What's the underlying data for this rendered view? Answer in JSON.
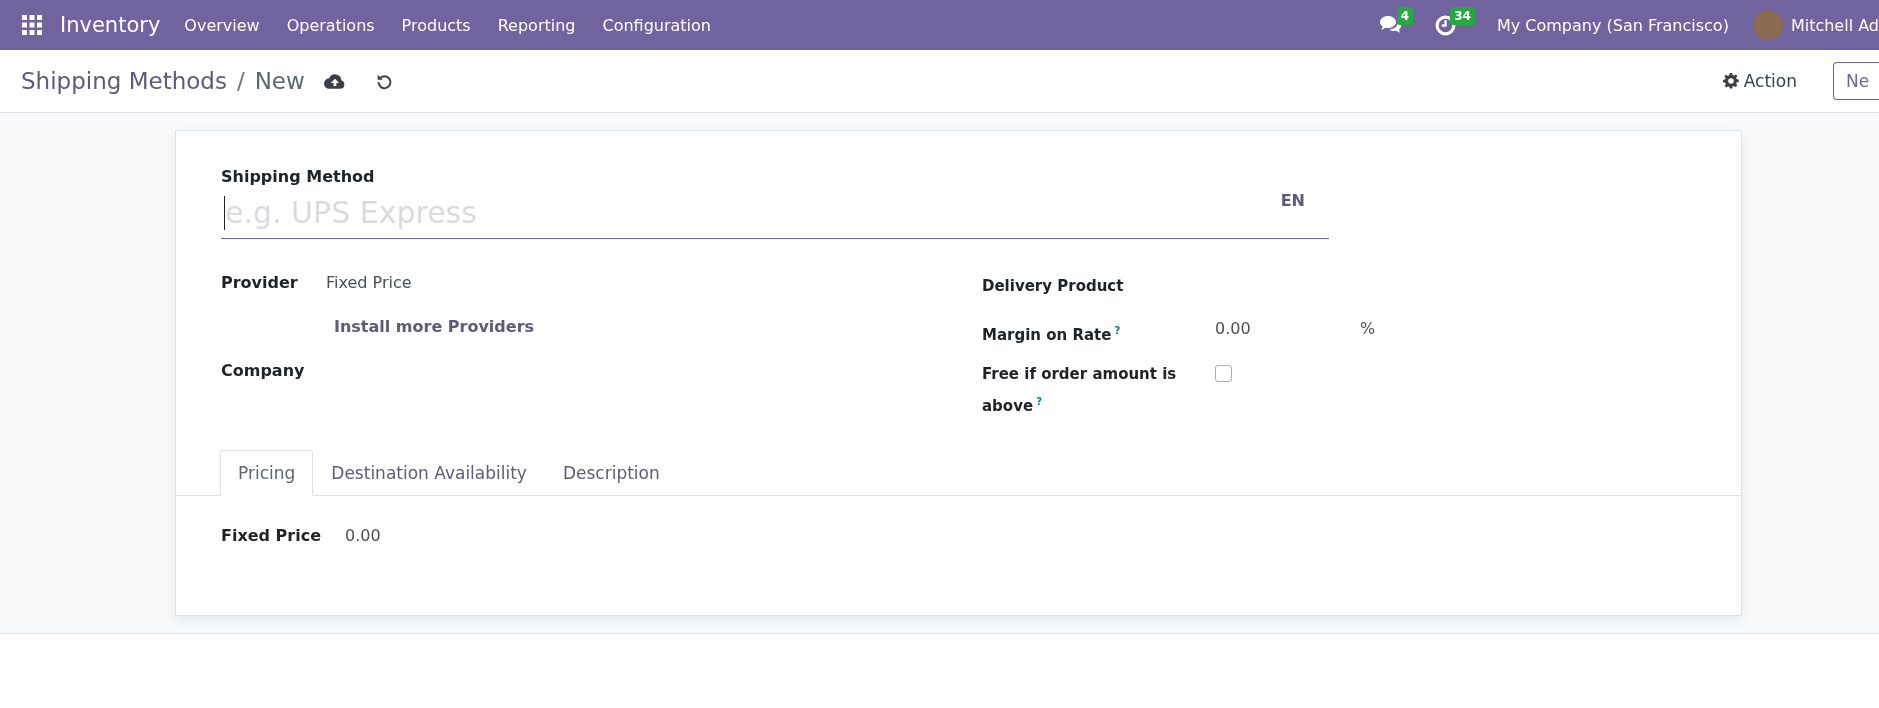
{
  "navbar": {
    "app_name": "Inventory",
    "menu": [
      "Overview",
      "Operations",
      "Products",
      "Reporting",
      "Configuration"
    ],
    "messages_badge": "4",
    "activities_badge": "34",
    "company": "My Company (San Francisco)",
    "user": "Mitchell Ad"
  },
  "control_panel": {
    "breadcrumb": "Shipping Methods",
    "separator": "/",
    "current": "New",
    "action_label": "Action",
    "new_button": "Ne"
  },
  "form": {
    "name_label": "Shipping Method",
    "name_placeholder": "e.g. UPS Express",
    "language": "EN",
    "left_fields": [
      {
        "kind": "value",
        "label": "Provider",
        "value": "Fixed Price"
      },
      {
        "kind": "link",
        "value": "Install more Providers"
      },
      {
        "kind": "empty",
        "label": "Company"
      }
    ],
    "right_fields": [
      {
        "kind": "empty",
        "label": "Delivery Product"
      },
      {
        "kind": "value",
        "label": "Margin on Rate",
        "help": "?",
        "value": "0.00",
        "unit": "%"
      },
      {
        "kind": "checkbox",
        "label": "Free if order amount is above",
        "help": "?",
        "checked": false
      }
    ],
    "tabs": [
      {
        "label": "Pricing",
        "selected": true
      },
      {
        "label": "Destination Availability",
        "selected": false
      },
      {
        "label": "Description",
        "selected": false
      }
    ],
    "pricing": [
      {
        "label": "Fixed Price",
        "value": "0.00"
      }
    ]
  }
}
